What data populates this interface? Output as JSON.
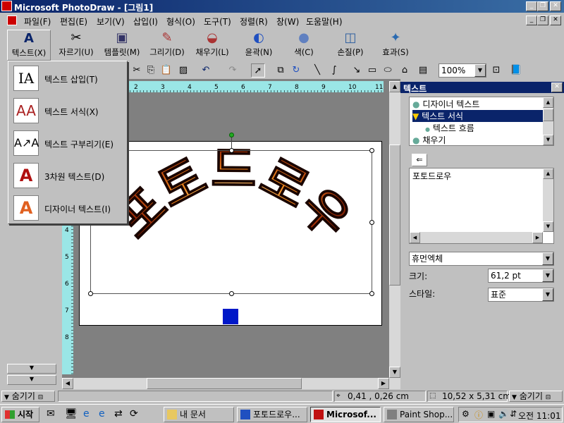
{
  "window": {
    "title": "Microsoft PhotoDraw - [그림1]"
  },
  "menubar": {
    "items": [
      "파일(F)",
      "편집(E)",
      "보기(V)",
      "삽입(I)",
      "형식(O)",
      "도구(T)",
      "정렬(R)",
      "창(W)",
      "도움말(H)"
    ]
  },
  "visual_menu": {
    "buttons": [
      {
        "label": "텍스트(X)",
        "icon": "text-A-icon"
      },
      {
        "label": "자르기(U)",
        "icon": "scissors-icon"
      },
      {
        "label": "템플릿(M)",
        "icon": "template-folder-icon"
      },
      {
        "label": "그리기(D)",
        "icon": "draw-pen-icon"
      },
      {
        "label": "채우기(L)",
        "icon": "paint-bucket-icon"
      },
      {
        "label": "윤곽(N)",
        "icon": "outline-icon"
      },
      {
        "label": "색(C)",
        "icon": "color-icon"
      },
      {
        "label": "손질(P)",
        "icon": "touchup-icon"
      },
      {
        "label": "효과(S)",
        "icon": "effects-icon"
      }
    ]
  },
  "text_menu": {
    "items": [
      {
        "label": "텍스트 삽입(T)",
        "icon": "insert-text-icon",
        "selected": true
      },
      {
        "label": "텍스트 서식(X)",
        "icon": "format-text-icon",
        "selected": false
      },
      {
        "label": "텍스트 구부리기(E)",
        "icon": "bend-text-icon",
        "selected": false
      },
      {
        "label": "3차원 텍스트(D)",
        "icon": "3d-text-icon",
        "selected": false
      },
      {
        "label": "디자이너 텍스트(I)",
        "icon": "designer-text-icon",
        "selected": false
      }
    ]
  },
  "toolbar": {
    "zoom": "100%"
  },
  "ruler": {
    "h_ticks": [
      "1",
      "2",
      "3",
      "4",
      "5",
      "6",
      "7",
      "8",
      "9",
      "10",
      "11"
    ],
    "v_ticks": [
      "1",
      "2",
      "3",
      "4",
      "5",
      "6",
      "7",
      "8"
    ]
  },
  "canvas": {
    "art_text": "포토드로우"
  },
  "right_panel": {
    "title": "텍스트",
    "tree": [
      {
        "label": "디자이너 텍스트",
        "selected": false,
        "indent": 0
      },
      {
        "label": "텍스트 서식",
        "selected": true,
        "indent": 0
      },
      {
        "label": "텍스트 흐름",
        "selected": false,
        "indent": 1
      },
      {
        "label": "채우기",
        "selected": false,
        "indent": 0
      }
    ],
    "text_value": "포토드로우",
    "font": "휴먼엑체",
    "size_label": "크기:",
    "size_value": "61,2 pt",
    "style_label": "스타일:",
    "style_value": "표준"
  },
  "status": {
    "hide_left": "숨기기",
    "coords": "0,41 , 0,26 cm",
    "size": "10,52 x 5,31 cm",
    "hide_right": "숨기기"
  },
  "taskbar": {
    "start": "시작",
    "tasks": [
      {
        "label": "내 문서",
        "icon": "folder-icon",
        "active": false
      },
      {
        "label": "포토드로우...",
        "icon": "word-icon",
        "active": false
      },
      {
        "label": "Microsof...",
        "icon": "photodraw-icon",
        "active": true
      },
      {
        "label": "Paint Shop...",
        "icon": "paintshop-icon",
        "active": false
      }
    ],
    "clock": "오전 11:01"
  },
  "colors": {
    "titlebar": "#0a246a",
    "selection": "#0a246a",
    "ruler": "#9ae6e6",
    "handle_blue": "#0018c8"
  }
}
